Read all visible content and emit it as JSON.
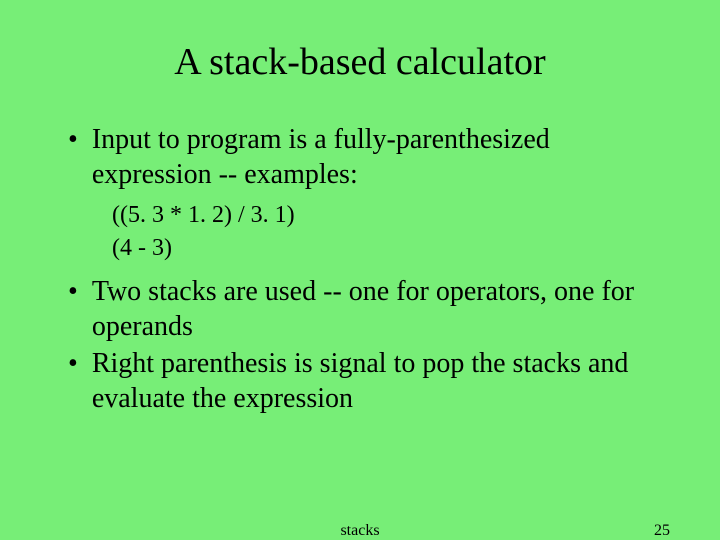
{
  "title": "A stack-based calculator",
  "bullets": [
    {
      "text": "Input to program is a fully-parenthesized expression -- examples:",
      "subs": [
        "((5. 3 * 1. 2) / 3. 1)",
        "(4 - 3)"
      ]
    },
    {
      "text": "Two stacks are used -- one for operators, one for operands",
      "subs": []
    },
    {
      "text": "Right parenthesis is signal to pop the stacks and evaluate the expression",
      "subs": []
    }
  ],
  "footer": {
    "center": "stacks",
    "page": "25"
  }
}
